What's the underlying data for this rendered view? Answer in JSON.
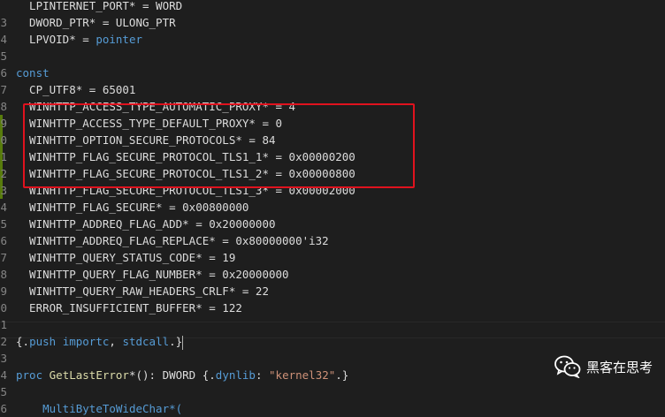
{
  "editor": {
    "lines": [
      {
        "num": "",
        "tokens": [
          {
            "c": "t-id",
            "t": "  LPINTERNET_PORT* = WORD"
          }
        ],
        "git": "none"
      },
      {
        "num": "3",
        "tokens": [
          {
            "c": "t-id",
            "t": "  DWORD_PTR* = ULONG_PTR"
          }
        ],
        "git": "none"
      },
      {
        "num": "4",
        "tokens": [
          {
            "c": "t-id",
            "t": "  LPVOID* = "
          },
          {
            "c": "t-kw",
            "t": "pointer"
          }
        ],
        "git": "none"
      },
      {
        "num": "5",
        "tokens": [],
        "git": "none"
      },
      {
        "num": "6",
        "tokens": [
          {
            "c": "t-kw",
            "t": "const"
          }
        ],
        "git": "none"
      },
      {
        "num": "7",
        "tokens": [
          {
            "c": "t-id",
            "t": "  CP_UTF8* = 65001"
          }
        ],
        "git": "none"
      },
      {
        "num": "8",
        "tokens": [
          {
            "c": "t-id",
            "t": "  WINHTTP_ACCESS_TYPE_AUTOMATIC_PROXY* = 4"
          }
        ],
        "git": "none"
      },
      {
        "num": "9",
        "tokens": [
          {
            "c": "t-id",
            "t": "  WINHTTP_ACCESS_TYPE_DEFAULT_PROXY* = 0"
          }
        ],
        "git": "added"
      },
      {
        "num": "0",
        "tokens": [
          {
            "c": "t-id",
            "t": "  WINHTTP_OPTION_SECURE_PROTOCOLS* = 84"
          }
        ],
        "git": "added"
      },
      {
        "num": "1",
        "tokens": [
          {
            "c": "t-id",
            "t": "  WINHTTP_FLAG_SECURE_PROTOCOL_TLS1_1* = 0x00000200"
          }
        ],
        "git": "added"
      },
      {
        "num": "2",
        "tokens": [
          {
            "c": "t-id",
            "t": "  WINHTTP_FLAG_SECURE_PROTOCOL_TLS1_2* = 0x00000800"
          }
        ],
        "git": "added"
      },
      {
        "num": "3",
        "tokens": [
          {
            "c": "t-id",
            "t": "  WINHTTP_FLAG_SECURE_PROTOCOL_TLS1_3* = 0x00002000"
          }
        ],
        "git": "added"
      },
      {
        "num": "4",
        "tokens": [
          {
            "c": "t-id",
            "t": "  WINHTTP_FLAG_SECURE* = 0x00800000"
          }
        ],
        "git": "none"
      },
      {
        "num": "5",
        "tokens": [
          {
            "c": "t-id",
            "t": "  WINHTTP_ADDREQ_FLAG_ADD* = 0x20000000"
          }
        ],
        "git": "none"
      },
      {
        "num": "6",
        "tokens": [
          {
            "c": "t-id",
            "t": "  WINHTTP_ADDREQ_FLAG_REPLACE* = 0x80000000'i32"
          }
        ],
        "git": "none"
      },
      {
        "num": "7",
        "tokens": [
          {
            "c": "t-id",
            "t": "  WINHTTP_QUERY_STATUS_CODE* = 19"
          }
        ],
        "git": "none"
      },
      {
        "num": "8",
        "tokens": [
          {
            "c": "t-id",
            "t": "  WINHTTP_QUERY_FLAG_NUMBER* = 0x20000000"
          }
        ],
        "git": "none"
      },
      {
        "num": "9",
        "tokens": [
          {
            "c": "t-id",
            "t": "  WINHTTP_QUERY_RAW_HEADERS_CRLF* = 22"
          }
        ],
        "git": "none"
      },
      {
        "num": "0",
        "tokens": [
          {
            "c": "t-id",
            "t": "  ERROR_INSUFFICIENT_BUFFER* = 122"
          }
        ],
        "git": "none"
      },
      {
        "num": "1",
        "tokens": [],
        "git": "none"
      },
      {
        "num": "2",
        "tokens": [
          {
            "c": "t-id",
            "t": "{."
          },
          {
            "c": "t-pragma",
            "t": "push"
          },
          {
            "c": "t-id",
            "t": " "
          },
          {
            "c": "t-pragma",
            "t": "importc"
          },
          {
            "c": "t-id",
            "t": ", "
          },
          {
            "c": "t-pragma",
            "t": "stdcall"
          },
          {
            "c": "t-id",
            "t": ".}"
          }
        ],
        "git": "none",
        "cursor": true
      },
      {
        "num": "3",
        "tokens": [],
        "git": "none"
      },
      {
        "num": "4",
        "tokens": [
          {
            "c": "t-kw",
            "t": "proc"
          },
          {
            "c": "t-id",
            "t": " "
          },
          {
            "c": "t-fn",
            "t": "GetLastError"
          },
          {
            "c": "t-id",
            "t": "*(): DWORD {."
          },
          {
            "c": "t-pragma",
            "t": "dynlib"
          },
          {
            "c": "t-id",
            "t": ": "
          },
          {
            "c": "t-str",
            "t": "\"kernel32\""
          },
          {
            "c": "t-id",
            "t": ".}"
          }
        ],
        "git": "none"
      },
      {
        "num": "5",
        "tokens": [],
        "git": "none"
      },
      {
        "num": "6",
        "tokens": [
          {
            "c": "t-id",
            "t": "    "
          },
          {
            "c": "t-kw",
            "t": "MultiByteToWideChar*("
          }
        ],
        "git": "none"
      }
    ]
  },
  "colors": {
    "git_added": "#587c0c",
    "highlight_box": "#e0121e"
  },
  "watermark": {
    "icon": "wechat-icon",
    "text": "黑客在思考"
  }
}
